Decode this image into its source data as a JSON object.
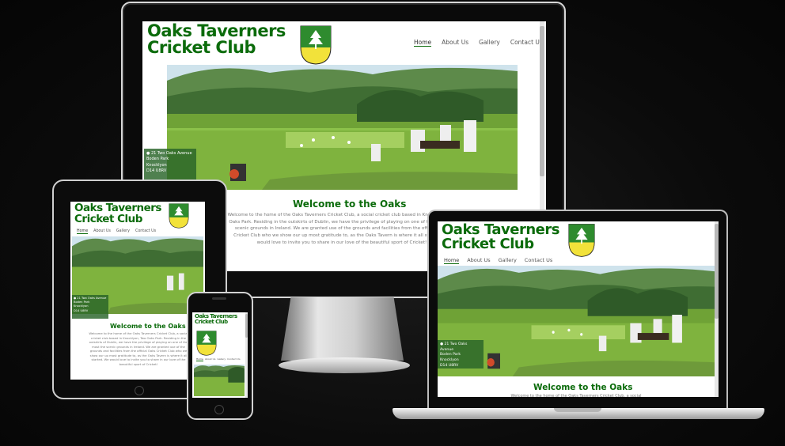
{
  "site": {
    "title_line1": "Oaks Taverners",
    "title_line2": "Cricket Club",
    "nav": [
      "Home",
      "About Us",
      "Gallery",
      "Contact Us"
    ],
    "address": [
      "21 Two Oaks Avenue",
      "Boden Park",
      "Knocklyon",
      "D14 U8RV"
    ],
    "welcome_heading": "Welcome to the Oaks",
    "welcome_text": "Welcome to the home of the Oaks Taverners Cricket Club, a social cricket club based in Knocklyon, Two Oaks Park. Residing in the outskirts of Dublin, we have the privilege of playing on one of the most the scenic grounds in Ireland. We are granted use of the grounds and facilities from the official Oaks Cricket Club who we show our up most gratitude to, as the Oaks Tavern is where it all started. We would love to invite you to share in our love of the beautiful sport of Cricket!",
    "laptop_text_fragment": "Welcome to the home of the Oaks Taverners Cricket Club, a social"
  },
  "colors": {
    "brand_green": "#0b6b0b",
    "crest_green": "#2e8b2e",
    "crest_yellow": "#f2e23a"
  },
  "icons": {
    "crest": "tree-shield-icon",
    "address_marker": "map-pin-icon"
  }
}
